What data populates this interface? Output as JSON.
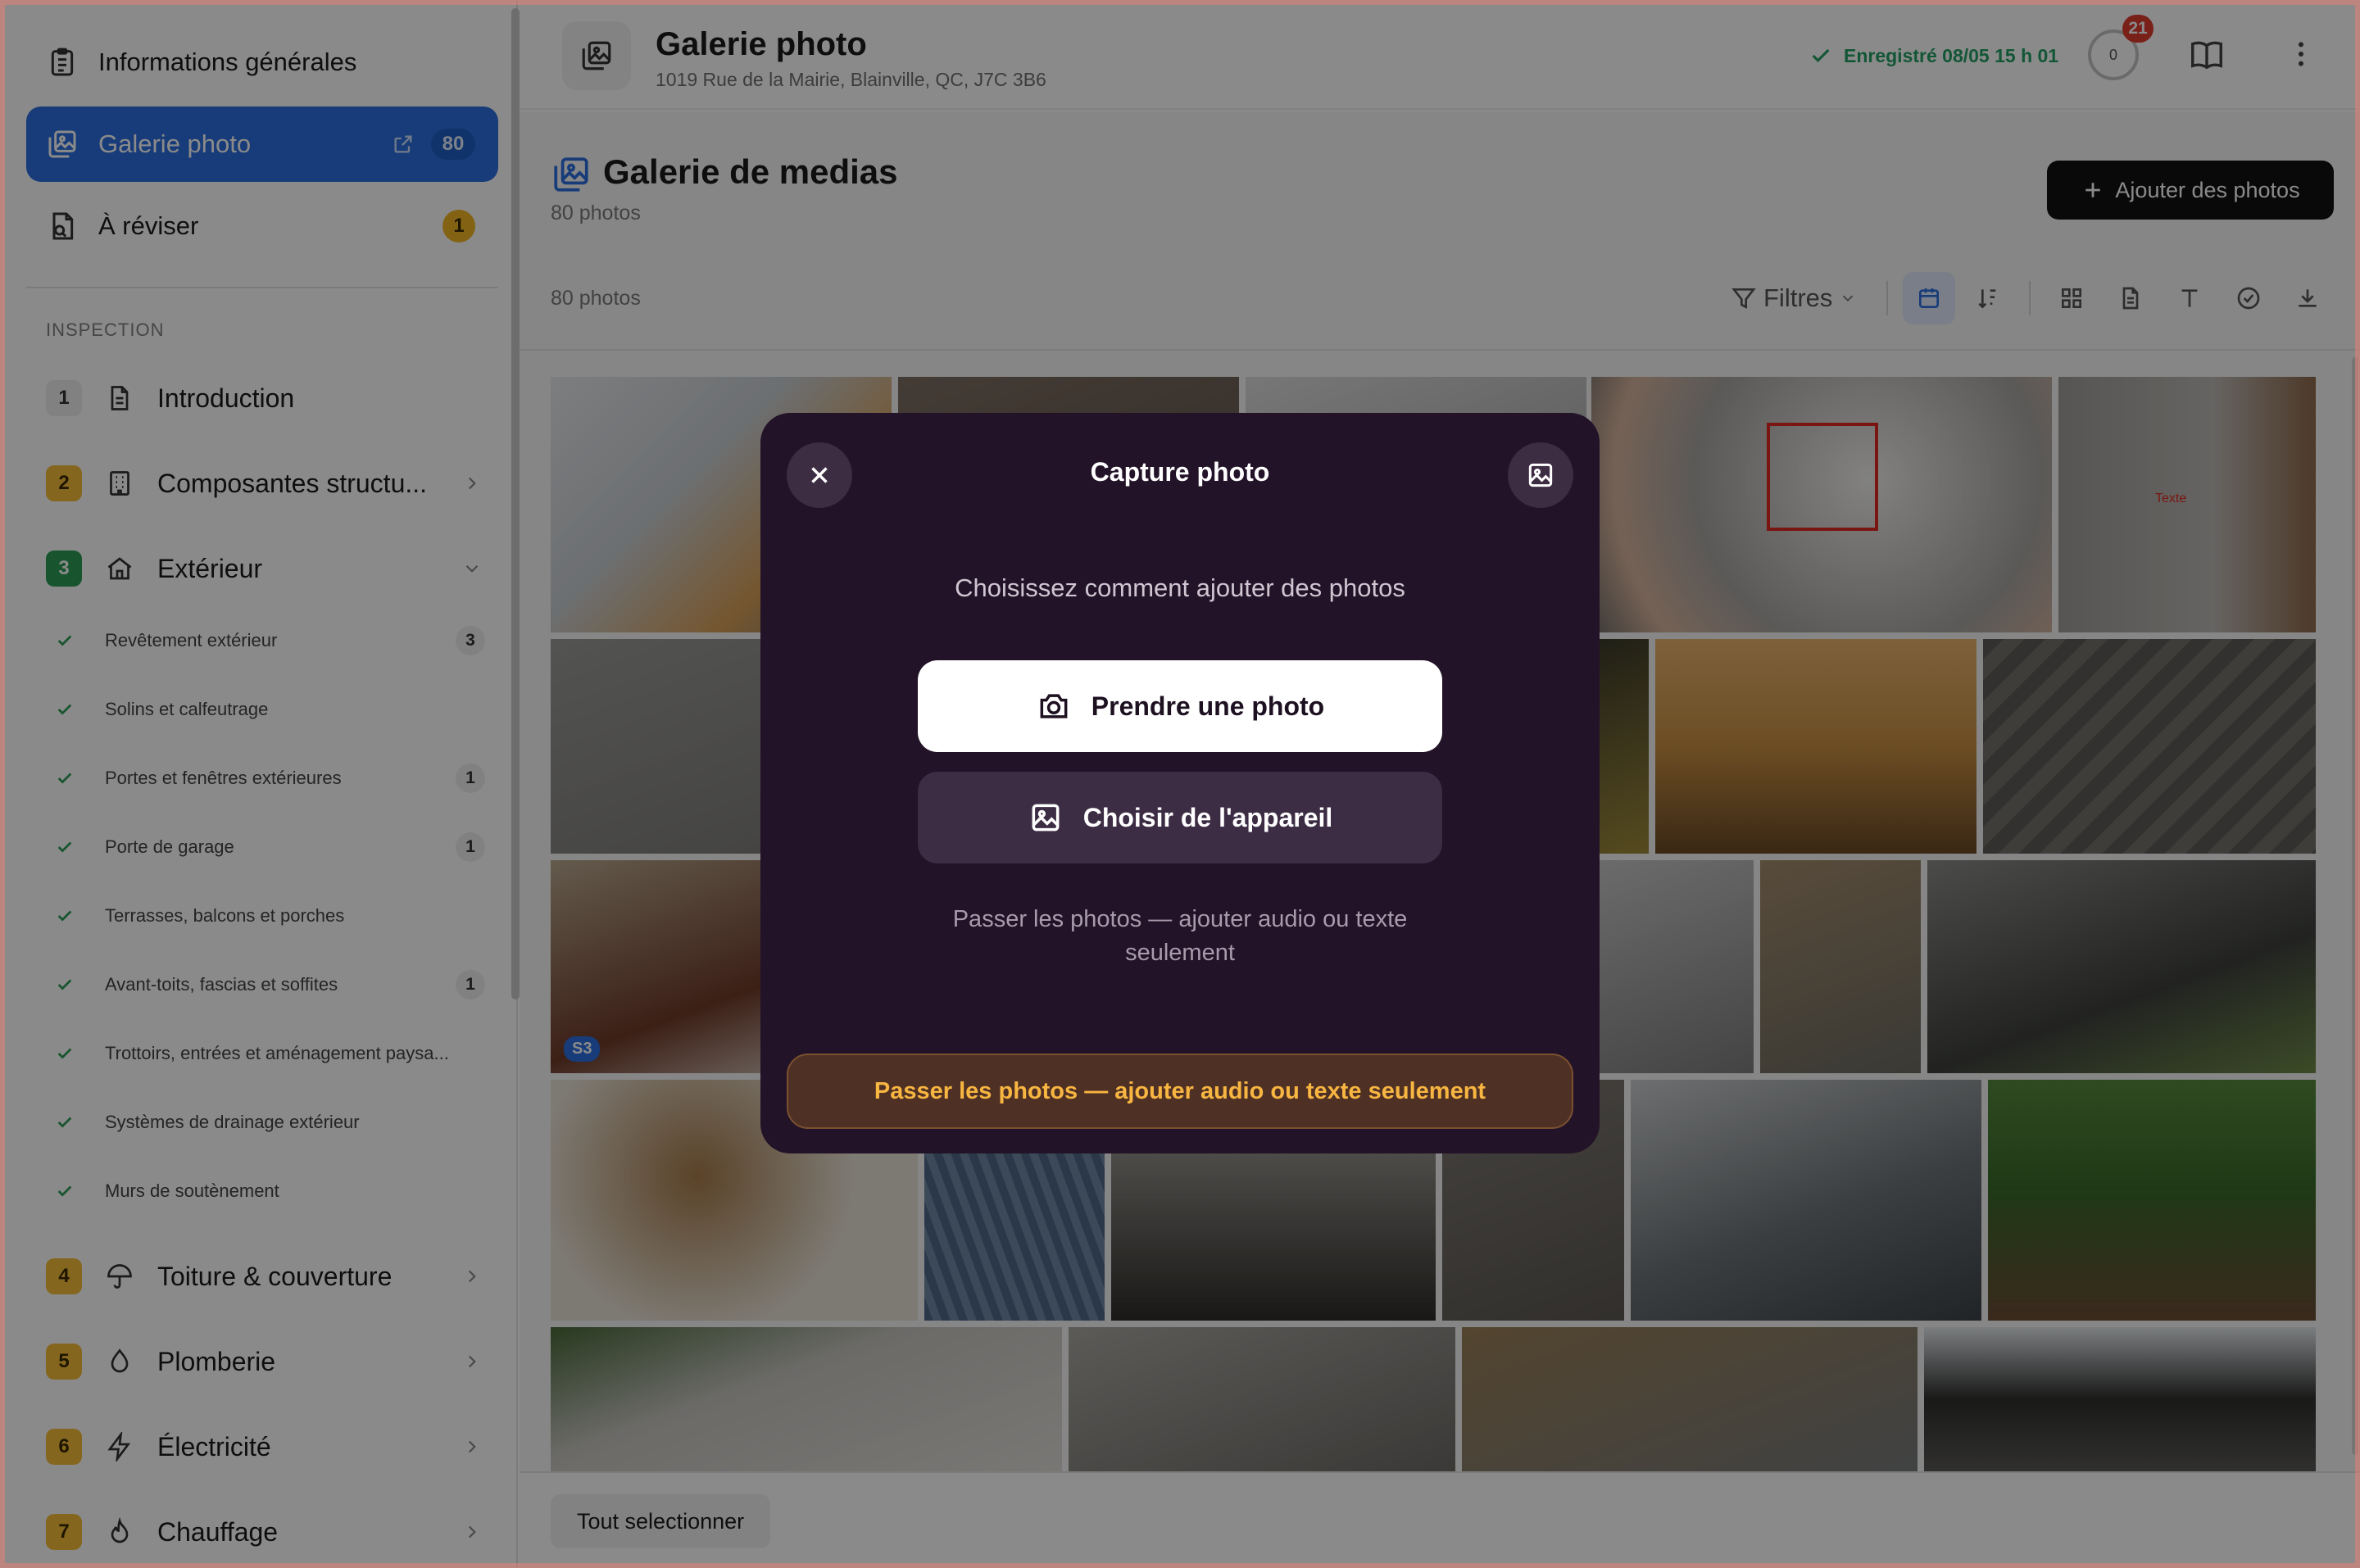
{
  "sidebar": {
    "top_items": [
      {
        "label": "Informations générales",
        "icon": "clipboard-icon"
      },
      {
        "label": "Galerie photo",
        "icon": "gallery-icon",
        "count": "80",
        "active": true
      },
      {
        "label": "À réviser",
        "icon": "review-icon",
        "badge": "1"
      }
    ],
    "section_label": "INSPECTION",
    "sections": [
      {
        "num": "1",
        "label": "Introduction",
        "icon": "document-icon",
        "num_color": "grey"
      },
      {
        "num": "2",
        "label": "Composantes structu...",
        "icon": "building-icon",
        "num_color": "yellow"
      },
      {
        "num": "3",
        "label": "Extérieur",
        "icon": "home-icon",
        "num_color": "green"
      }
    ],
    "subitems": [
      {
        "label": "Revêtement extérieur",
        "count": "3"
      },
      {
        "label": "Solins et calfeutrage",
        "count": ""
      },
      {
        "label": "Portes et fenêtres extérieures",
        "count": "1"
      },
      {
        "label": "Porte de garage",
        "count": "1"
      },
      {
        "label": "Terrasses, balcons et porches",
        "count": ""
      },
      {
        "label": "Avant-toits, fascias et soffites",
        "count": "1"
      },
      {
        "label": "Trottoirs, entrées et aménagement paysa...",
        "count": ""
      },
      {
        "label": "Systèmes de drainage extérieur",
        "count": ""
      },
      {
        "label": "Murs de soutènement",
        "count": ""
      }
    ],
    "sections_more": [
      {
        "num": "4",
        "label": "Toiture & couverture",
        "icon": "umbrella-icon",
        "num_color": "yellow"
      },
      {
        "num": "5",
        "label": "Plomberie",
        "icon": "droplet-icon",
        "num_color": "yellow"
      },
      {
        "num": "6",
        "label": "Électricité",
        "icon": "bolt-icon",
        "num_color": "yellow"
      },
      {
        "num": "7",
        "label": "Chauffage",
        "icon": "flame-icon",
        "num_color": "yellow"
      }
    ]
  },
  "header": {
    "title": "Galerie photo",
    "address": "1019 Rue de la Mairie, Blainville, QC, J7C 3B6",
    "saved": "Enregistré 08/05 15 h 01",
    "progress": "0",
    "notifications": "21"
  },
  "gallery": {
    "title": "Galerie de medias",
    "count": "80 photos",
    "add_button": "Ajouter des photos",
    "toolbar_count": "80 photos",
    "filters_label": "Filtres",
    "select_all": "Tout selectionner",
    "photo_tag": "S3",
    "photo_annotation": "Texte"
  },
  "modal": {
    "title": "Capture photo",
    "prompt": "Choisissez comment ajouter des photos",
    "take_photo": "Prendre une photo",
    "choose_device": "Choisir de l'appareil",
    "skip_link": "Passer les photos — ajouter audio ou texte seulement",
    "skip_button": "Passer les photos — ajouter audio ou texte seulement"
  },
  "colors": {
    "accent": "#2c6fe0",
    "modal_bg": "#231328",
    "skip_text": "#f7b541",
    "saved_green": "#24a064",
    "notification_red": "#e03b2f"
  }
}
